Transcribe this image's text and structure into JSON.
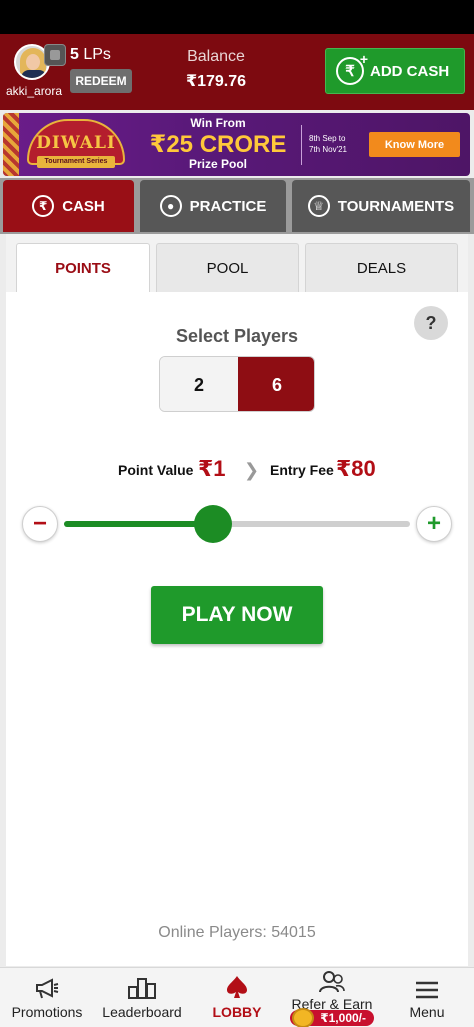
{
  "header": {
    "username": "akki_arora",
    "lps_number": "5",
    "lps_suffix": " LPs",
    "redeem_label": "REDEEM",
    "balance_label": "Balance",
    "balance_value": "₹179.76",
    "add_cash_label": "ADD CASH"
  },
  "banner": {
    "diwali_title": "DIWALI",
    "diwali_subtitle": "Tournament Series",
    "win_from": "Win From",
    "amount": "₹25 CRORE",
    "prize_pool": "Prize Pool",
    "dates_line1": "8th Sep to",
    "dates_line2": "7th Nov'21",
    "know_more": "Know More"
  },
  "game_tabs": [
    {
      "label": "CASH",
      "icon": "rupee-icon"
    },
    {
      "label": "PRACTICE",
      "icon": "chip-icon"
    },
    {
      "label": "TOURNAMENTS",
      "icon": "trophy-icon"
    }
  ],
  "sub_tabs": [
    {
      "label": "POINTS"
    },
    {
      "label": "POOL"
    },
    {
      "label": "DEALS"
    }
  ],
  "points": {
    "help_label": "?",
    "select_players_title": "Select Players",
    "player_options": [
      "2",
      "6"
    ],
    "selected_players": "6",
    "point_value_label": "Point Value",
    "point_value": "₹1",
    "entry_fee_label": "Entry Fee",
    "entry_fee": "₹80",
    "slider_fraction": 0.43,
    "play_now_label": "PLAY NOW",
    "online_players": "Online Players: 54015"
  },
  "bottom_nav": [
    {
      "label": "Promotions",
      "icon": "megaphone-icon"
    },
    {
      "label": "Leaderboard",
      "icon": "podium-icon"
    },
    {
      "label": "LOBBY",
      "icon": "spade-icon"
    },
    {
      "label": "Refer & Earn",
      "icon": "people-icon",
      "badge": "₹1,000/-"
    },
    {
      "label": "Menu",
      "icon": "hamburger-icon"
    }
  ],
  "colors": {
    "header_bg": "#7d0a10",
    "active_red": "#990f16",
    "green": "#1f9a2b"
  }
}
